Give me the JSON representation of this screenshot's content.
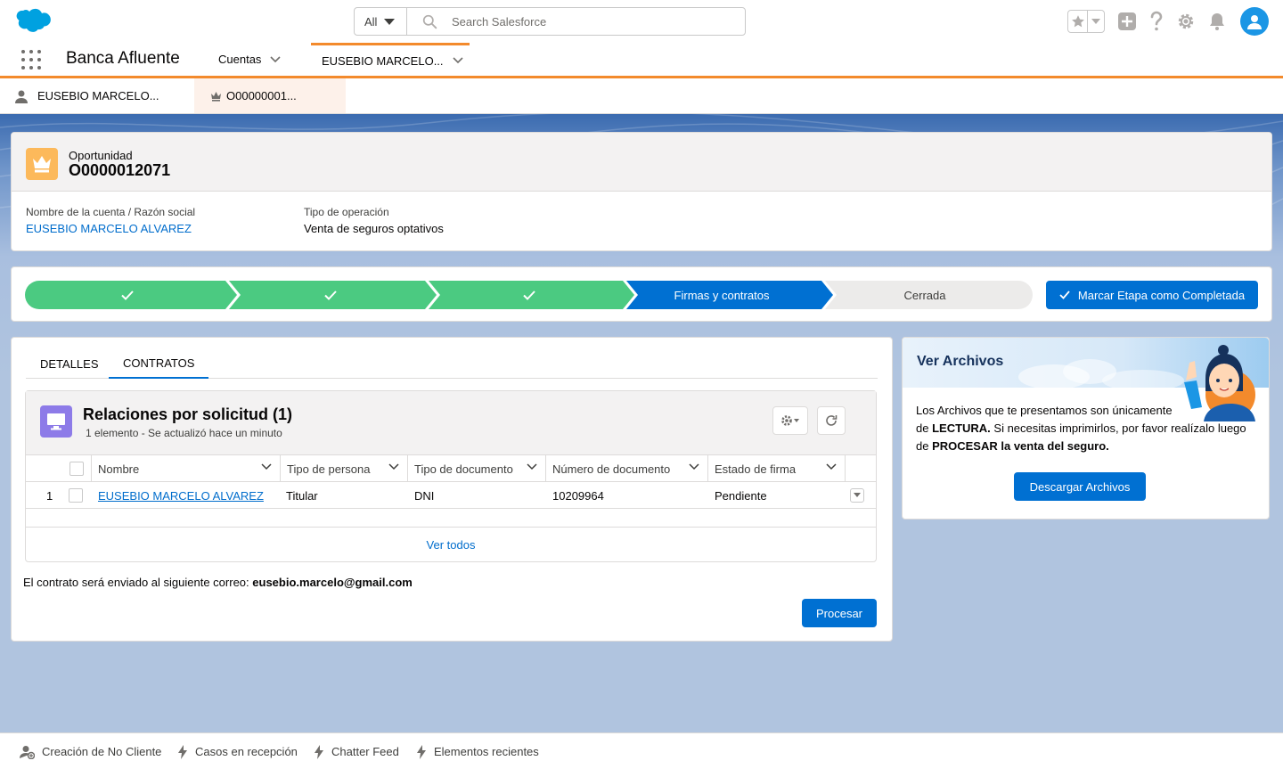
{
  "header": {
    "search_scope": "All",
    "search_placeholder": "Search Salesforce"
  },
  "nav": {
    "app_name": "Banca Afluente",
    "items": [
      {
        "label": "Cuentas"
      },
      {
        "label": "EUSEBIO MARCELO..."
      }
    ]
  },
  "subtabs": [
    {
      "label": "EUSEBIO MARCELO..."
    },
    {
      "label": "O00000001..."
    }
  ],
  "record": {
    "object_type": "Oportunidad",
    "name": "O0000012071",
    "fields": [
      {
        "label": "Nombre de la cuenta / Razón social",
        "value": "EUSEBIO MARCELO ALVAREZ"
      },
      {
        "label": "Tipo de operación",
        "value": "Venta de seguros optativos"
      }
    ]
  },
  "path": {
    "steps": [
      {
        "label": "",
        "status": "complete"
      },
      {
        "label": "",
        "status": "complete"
      },
      {
        "label": "",
        "status": "complete"
      },
      {
        "label": "Firmas y contratos",
        "status": "current"
      },
      {
        "label": "Cerrada",
        "status": "incomplete"
      }
    ],
    "button_label": "Marcar Etapa como Completada",
    "colors": {
      "complete": "#4bca81",
      "current": "#0070d2",
      "incomplete": "#ecebea"
    }
  },
  "tabs": [
    {
      "label": "DETALLES"
    },
    {
      "label": "CONTRATOS"
    }
  ],
  "related_list": {
    "title": "Relaciones por solicitud (1)",
    "subtitle": "1 elemento - Se actualizó hace un minuto",
    "columns": [
      "Nombre",
      "Tipo de persona",
      "Tipo de documento",
      "Número de documento",
      "Estado de firma"
    ],
    "rows": [
      {
        "num": "1",
        "nombre": "EUSEBIO MARCELO ALVAREZ",
        "tipo_persona": "Titular",
        "tipo_documento": "DNI",
        "numero_documento": "10209964",
        "estado_firma": "Pendiente"
      }
    ],
    "view_all": "Ver todos"
  },
  "contract": {
    "email_prefix": "El contrato será enviado al siguiente correo:",
    "email": "eusebio.marcelo@gmail.com",
    "process_button": "Procesar"
  },
  "side_panel": {
    "title": "Ver Archivos",
    "text_1": "Los Archivos que te presentamos son únicamente",
    "text_2a": "de ",
    "text_2b": "LECTURA.",
    "text_2c": " Si necesitas imprimirlos, por favor realízalo luego",
    "text_3a": "de ",
    "text_3b": "PROCESAR la venta del seguro.",
    "button": "Descargar Archivos"
  },
  "utility_bar": {
    "items": [
      {
        "label": "Creación de No Cliente"
      },
      {
        "label": "Casos en recepción"
      },
      {
        "label": "Chatter Feed"
      },
      {
        "label": "Elementos recientes"
      }
    ]
  }
}
